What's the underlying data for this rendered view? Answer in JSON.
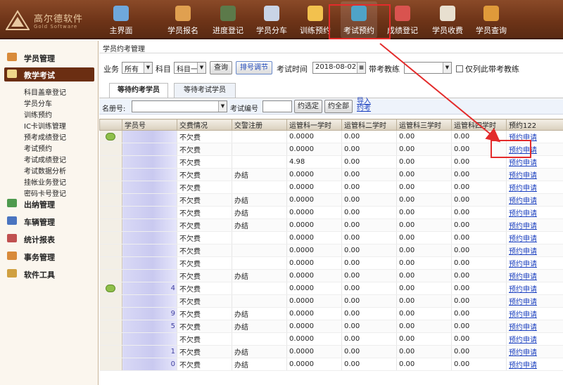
{
  "logo": {
    "name": "高尔德软件",
    "slogan": "Gold Software"
  },
  "toolbar": [
    {
      "label": "主界面",
      "icon": "home-icon",
      "color": "#6fa8dc"
    },
    {
      "label": "学员报名",
      "icon": "student-register-icon",
      "color": "#e0a050"
    },
    {
      "label": "进度登记",
      "icon": "progress-icon",
      "color": "#5c7a4a"
    },
    {
      "label": "学员分车",
      "icon": "car-assign-icon",
      "color": "#c9d4e6"
    },
    {
      "label": "训练预约",
      "icon": "training-booking-icon",
      "color": "#f2c14e"
    },
    {
      "label": "考试预约",
      "icon": "exam-booking-icon",
      "color": "#4fa3c7"
    },
    {
      "label": "成绩登记",
      "icon": "score-icon",
      "color": "#d9534f"
    },
    {
      "label": "学员收费",
      "icon": "fee-icon",
      "color": "#e8e0d0"
    },
    {
      "label": "学员查询",
      "icon": "student-search-icon",
      "color": "#e09a3a"
    }
  ],
  "sidebar": {
    "groups": [
      {
        "label": "学员管理",
        "icon": "students-icon",
        "color": "#d88a3a"
      },
      {
        "label": "教学考试",
        "icon": "teaching-exam-icon",
        "color": "#f0d68a"
      },
      {
        "label": "出纳管理",
        "icon": "cashier-icon",
        "color": "#4e9a4e"
      },
      {
        "label": "车辆管理",
        "icon": "vehicle-icon",
        "color": "#4a74c0"
      },
      {
        "label": "统计报表",
        "icon": "report-icon",
        "color": "#c05050"
      },
      {
        "label": "事务管理",
        "icon": "affairs-icon",
        "color": "#d88a3a"
      },
      {
        "label": "软件工具",
        "icon": "tools-icon",
        "color": "#d0a040"
      }
    ],
    "subitems": [
      "科目盖章登记",
      "学员分车",
      "训练预约",
      "IC卡训练管理",
      "预考成绩登记",
      "考试预约",
      "考试成绩登记",
      "考试数据分析",
      "挂帐业务登记",
      "密码卡号登记"
    ]
  },
  "main": {
    "breadcrumb": "学员约考管理",
    "filters": {
      "business_label": "业务",
      "business_value": "所有",
      "subject_label": "科目",
      "subject_value": "科目一",
      "query_button": "查询",
      "number_adjust_button": "排号调节",
      "exam_time_label": "考试时间",
      "exam_time_value": "2018-08-02",
      "coach_label": "带考教练",
      "coach_value": "",
      "only_coach_label": "仅列此带考教练"
    },
    "tabs": [
      "等待约考学员",
      "等待考试学员"
    ],
    "subbar": {
      "roster_label": "名册号:",
      "exam_no_label": "考试编号",
      "select_button": "约选定",
      "all_button": "约全部",
      "import_link": "导入约考"
    },
    "grid": {
      "columns": [
        "",
        "学员号",
        "交费情况",
        "交警注册",
        "运管科一学时",
        "运管科二学时",
        "运管科三学时",
        "运管科四学时",
        "预约122"
      ],
      "rows": [
        {
          "badge": true,
          "id": "",
          "fee": "不欠费",
          "reg": "",
          "s1": "0.0000",
          "s2": "0.00",
          "s3": "0.00",
          "s4": "0.00",
          "action": "预约申请"
        },
        {
          "badge": false,
          "id": "",
          "fee": "不欠费",
          "reg": "",
          "s1": "0.0000",
          "s2": "0.00",
          "s3": "0.00",
          "s4": "0.00",
          "action": "预约申请"
        },
        {
          "badge": false,
          "id": "",
          "fee": "不欠费",
          "reg": "",
          "s1": "4.98",
          "s2": "0.00",
          "s3": "0.00",
          "s4": "0.00",
          "action": "预约申请"
        },
        {
          "badge": false,
          "id": "",
          "fee": "不欠费",
          "reg": "办结",
          "s1": "0.0000",
          "s2": "0.00",
          "s3": "0.00",
          "s4": "0.00",
          "action": "预约申请"
        },
        {
          "badge": false,
          "id": "",
          "fee": "不欠费",
          "reg": "",
          "s1": "0.0000",
          "s2": "0.00",
          "s3": "0.00",
          "s4": "0.00",
          "action": "预约申请"
        },
        {
          "badge": false,
          "id": "",
          "fee": "不欠费",
          "reg": "办结",
          "s1": "0.0000",
          "s2": "0.00",
          "s3": "0.00",
          "s4": "0.00",
          "action": "预约申请"
        },
        {
          "badge": false,
          "id": "",
          "fee": "不欠费",
          "reg": "办结",
          "s1": "0.0000",
          "s2": "0.00",
          "s3": "0.00",
          "s4": "0.00",
          "action": "预约申请"
        },
        {
          "badge": false,
          "id": "",
          "fee": "不欠费",
          "reg": "办结",
          "s1": "0.0000",
          "s2": "0.00",
          "s3": "0.00",
          "s4": "0.00",
          "action": "预约申请"
        },
        {
          "badge": false,
          "id": "",
          "fee": "不欠费",
          "reg": "",
          "s1": "0.0000",
          "s2": "0.00",
          "s3": "0.00",
          "s4": "0.00",
          "action": "预约申请"
        },
        {
          "badge": false,
          "id": "",
          "fee": "不欠费",
          "reg": "",
          "s1": "0.0000",
          "s2": "0.00",
          "s3": "0.00",
          "s4": "0.00",
          "action": "预约申请"
        },
        {
          "badge": false,
          "id": "",
          "fee": "不欠费",
          "reg": "",
          "s1": "0.0000",
          "s2": "0.00",
          "s3": "0.00",
          "s4": "0.00",
          "action": "预约申请"
        },
        {
          "badge": false,
          "id": "",
          "fee": "不欠费",
          "reg": "办结",
          "s1": "0.0000",
          "s2": "0.00",
          "s3": "0.00",
          "s4": "0.00",
          "action": "预约申请"
        },
        {
          "badge": true,
          "id": "4",
          "fee": "不欠费",
          "reg": "",
          "s1": "0.0000",
          "s2": "0.00",
          "s3": "0.00",
          "s4": "0.00",
          "action": "预约申请"
        },
        {
          "badge": false,
          "id": "",
          "fee": "不欠费",
          "reg": "",
          "s1": "0.0000",
          "s2": "0.00",
          "s3": "0.00",
          "s4": "0.00",
          "action": "预约申请"
        },
        {
          "badge": false,
          "id": "9",
          "fee": "不欠费",
          "reg": "办结",
          "s1": "0.0000",
          "s2": "0.00",
          "s3": "0.00",
          "s4": "0.00",
          "action": "预约申请"
        },
        {
          "badge": false,
          "id": "5",
          "fee": "不欠费",
          "reg": "办结",
          "s1": "0.0000",
          "s2": "0.00",
          "s3": "0.00",
          "s4": "0.00",
          "action": "预约申请"
        },
        {
          "badge": false,
          "id": "",
          "fee": "不欠费",
          "reg": "",
          "s1": "0.0000",
          "s2": "0.00",
          "s3": "0.00",
          "s4": "0.00",
          "action": "预约申请"
        },
        {
          "badge": false,
          "id": "1",
          "fee": "不欠费",
          "reg": "办结",
          "s1": "0.0000",
          "s2": "0.00",
          "s3": "0.00",
          "s4": "0.00",
          "action": "预约申请"
        },
        {
          "badge": false,
          "id": "0",
          "fee": "不欠费",
          "reg": "办结",
          "s1": "0.0000",
          "s2": "0.00",
          "s3": "0.00",
          "s4": "0.00",
          "action": "预约申请"
        }
      ]
    }
  },
  "annotation_color": "#e32b2b"
}
